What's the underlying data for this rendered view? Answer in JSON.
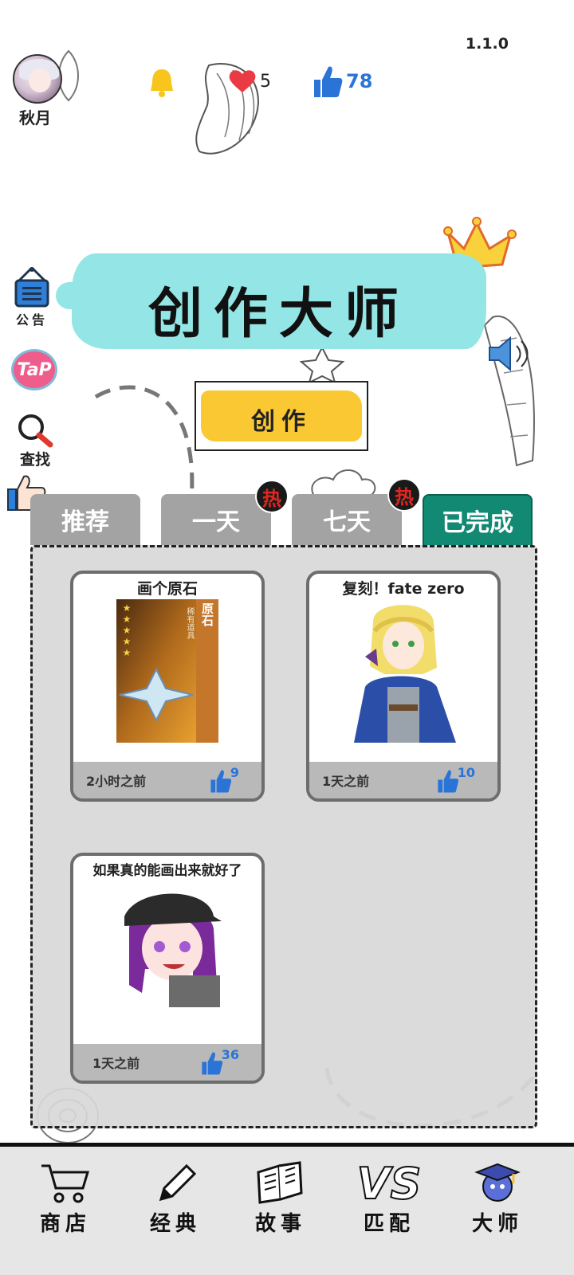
{
  "app": {
    "version": "1.1.0",
    "title": "创作大师"
  },
  "user": {
    "name": "秋月"
  },
  "stats": {
    "hearts": "5",
    "likes": "78"
  },
  "side": {
    "notice_label": "公告",
    "tap_label": "TaP",
    "search_label": "查找"
  },
  "create_button": "创作",
  "tabs": [
    {
      "label": "推荐"
    },
    {
      "label": "一天",
      "badge": "热"
    },
    {
      "label": "七天",
      "badge": "热"
    },
    {
      "label": "已完成"
    }
  ],
  "cards": [
    {
      "title": "画个原石",
      "time": "2小时之前",
      "likes": "9",
      "stars": "★★★★★",
      "art_label": "原石",
      "art_sub": "稀有道具"
    },
    {
      "title": "复刻！fate zero",
      "time": "1天之前",
      "likes": "10"
    },
    {
      "title": "如果真的能画出来就好了",
      "time": "1天之前",
      "likes": "36"
    }
  ],
  "nav": [
    {
      "label": "商店",
      "icon": "cart-icon"
    },
    {
      "label": "经典",
      "icon": "pencil-icon"
    },
    {
      "label": "故事",
      "icon": "book-icon"
    },
    {
      "label": "匹配",
      "icon": "vs-icon",
      "glyph": "VS"
    },
    {
      "label": "大师",
      "icon": "graduation-cap-icon"
    }
  ],
  "colors": {
    "active_tab": "#128a73",
    "inactive_tab": "#a3a3a3",
    "banner": "#93e6e5",
    "create_button": "#fac832",
    "like_blue": "#2a74d8"
  }
}
